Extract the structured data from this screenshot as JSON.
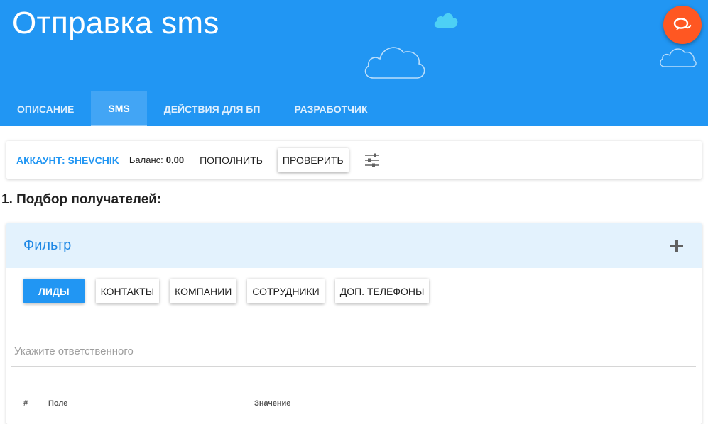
{
  "header": {
    "title": "Отправка sms"
  },
  "tabs": [
    {
      "label": "ОПИСАНИЕ",
      "active": false
    },
    {
      "label": "SMS",
      "active": true
    },
    {
      "label": "ДЕЙСТВИЯ ДЛЯ БП",
      "active": false
    },
    {
      "label": "РАЗРАБОТЧИК",
      "active": false
    }
  ],
  "account": {
    "account_label": "АККАУНТ: SHEVCHIK",
    "balance_label": "Баланс:",
    "balance_value": "0,00",
    "topup_label": "ПОПОЛНИТЬ",
    "check_label": "ПРОВЕРИТЬ",
    "settings_icon": "sliders-icon"
  },
  "section": {
    "title": "1. Подбор получателей:"
  },
  "filter": {
    "title": "Фильтр",
    "add_icon": "plus-icon"
  },
  "entity_buttons": [
    {
      "label": "ЛИДЫ",
      "selected": true
    },
    {
      "label": "КОНТАКТЫ",
      "selected": false
    },
    {
      "label": "КОМПАНИИ",
      "selected": false
    },
    {
      "label": "СОТРУДНИКИ",
      "selected": false
    },
    {
      "label": "ДОП. ТЕЛЕФОНЫ",
      "selected": false
    }
  ],
  "responsible": {
    "placeholder": "Укажите ответственного",
    "value": ""
  },
  "table": {
    "columns": [
      "#",
      "Поле",
      "Значение"
    ]
  },
  "colors": {
    "header_bg": "#2196f3",
    "active_tab_bg": "#42a5f5",
    "accent": "#2196f3",
    "fab": "#ff5722",
    "filter_head_bg": "#e3f2fd"
  }
}
